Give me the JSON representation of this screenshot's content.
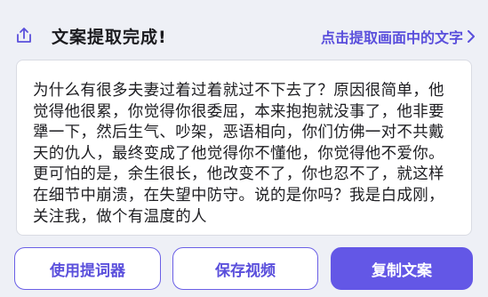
{
  "header": {
    "title": "文案提取完成!",
    "extract_link_label": "点击提取画面中的文字",
    "share_icon": "share-upload-icon",
    "chevron_icon": "chevron-right-icon"
  },
  "content": {
    "text": "为什么有很多夫妻过着过着就过不下去了？原因很简单，他觉得他很累，你觉得你很委屈，本来抱抱就没事了，他非要犟一下，然后生气、吵架，恶语相向，你们仿佛一对不共戴天的仇人，最终变成了他觉得你不懂他，你觉得他不爱你。更可怕的是，余生很长，他改变不了，你也忍不了，就这样在细节中崩溃，在失望中防守。说的是你吗？我是白成刚，关注我，做个有温度的人"
  },
  "buttons": {
    "teleprompter": "使用提词器",
    "save_video": "保存视频",
    "copy_text": "复制文案"
  },
  "colors": {
    "accent": "#6357e6",
    "accent_text": "#5a4fdc",
    "background": "#eef0f6"
  }
}
